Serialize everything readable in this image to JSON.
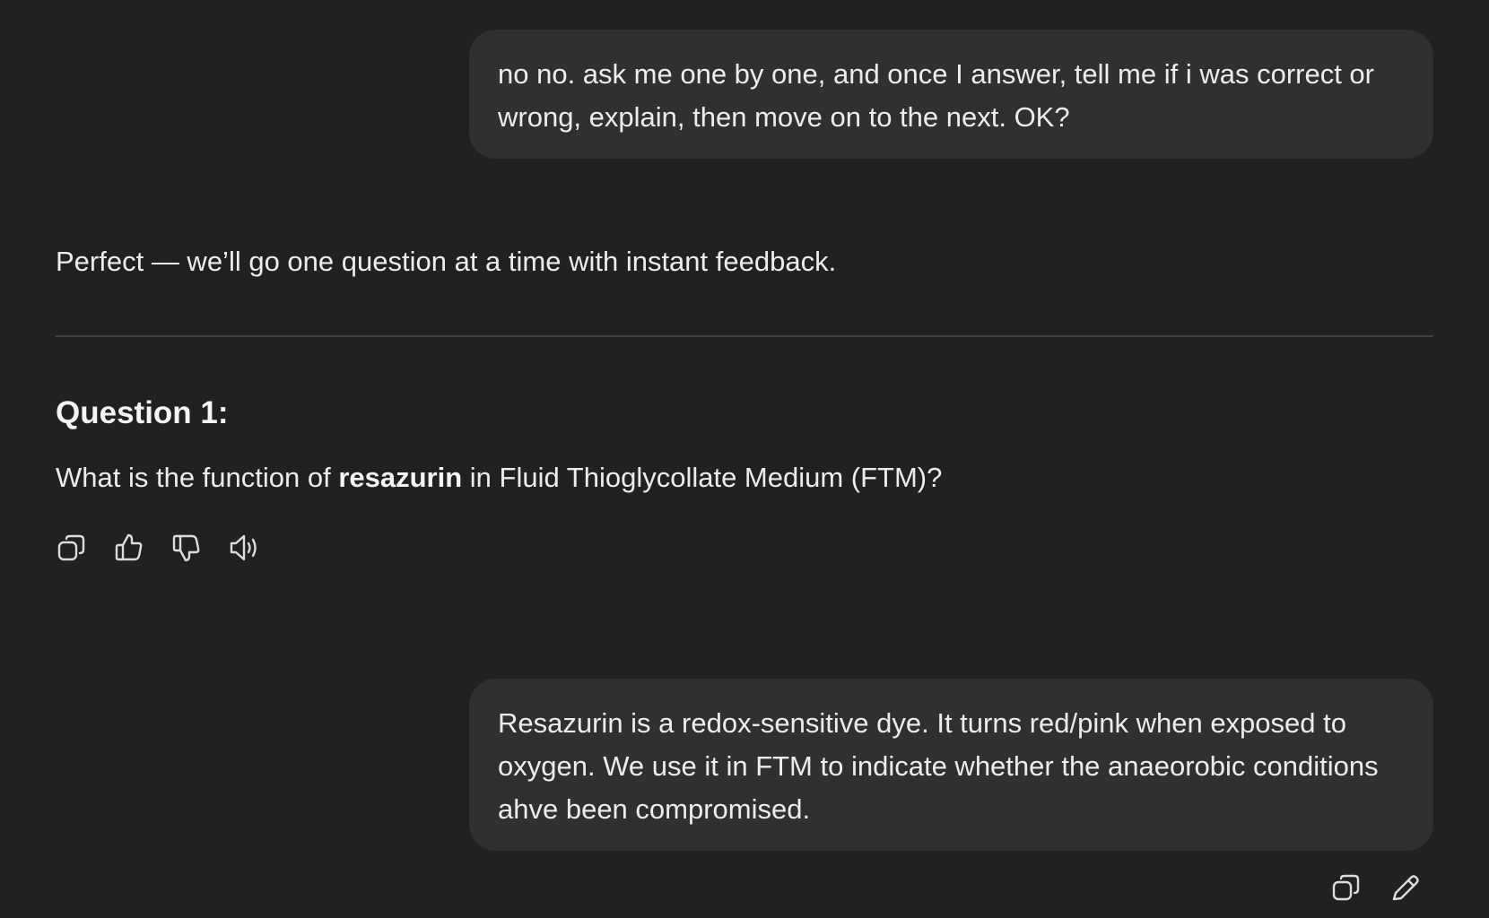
{
  "conversation": {
    "user_message_1": "no no. ask me one by one, and once I answer, tell me if i was correct or wrong, explain, then move on to the next. OK?",
    "assistant_reply": {
      "intro": "Perfect — we’ll go one question at a time with instant feedback.",
      "question_heading": "Question 1:",
      "question_prefix": "What is the function of ",
      "question_bold": "resazurin",
      "question_suffix": " in Fluid Thioglycollate Medium (FTM)?"
    },
    "user_message_2": "Resazurin is a redox-sensitive dye. It turns red/pink when exposed to oxygen. We use it in FTM to indicate whether the anaeorobic conditions ahve been compromised."
  },
  "assistant_actions": [
    "copy-icon",
    "thumbs-up-icon",
    "thumbs-down-icon",
    "speaker-icon"
  ],
  "user_actions": [
    "copy-icon",
    "pencil-icon"
  ],
  "colors": {
    "background": "#212121",
    "bubble": "#303030",
    "text": "#ececec",
    "divider": "#424242"
  }
}
